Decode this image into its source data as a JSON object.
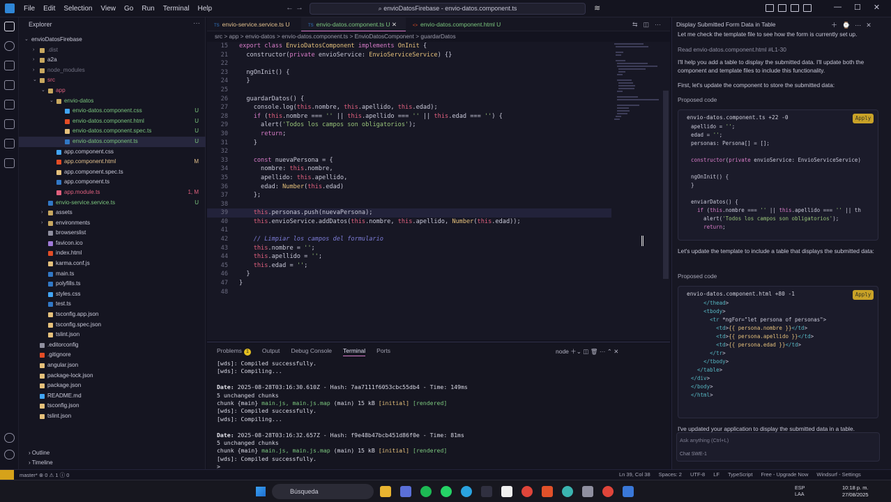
{
  "menu": [
    "File",
    "Edit",
    "Selection",
    "View",
    "Go",
    "Run",
    "Terminal",
    "Help"
  ],
  "title_search": "envioDatosFirebase - envio-datos.component.ts",
  "explorer": {
    "header": "Explorer",
    "outline": "Outline",
    "timeline": "Timeline",
    "items": [
      {
        "label": "envioDatosFirebase",
        "depth": 0,
        "type": "root",
        "color": "#c8c8d8",
        "badge": "",
        "open": true
      },
      {
        "label": ".dist",
        "depth": 1,
        "type": "folder",
        "color": "#6f6f80",
        "badge": "",
        "open": false
      },
      {
        "label": "a2a",
        "depth": 1,
        "type": "folder",
        "color": "#c8c8d8",
        "badge": "",
        "open": false
      },
      {
        "label": "node_modules",
        "depth": 1,
        "type": "folder",
        "color": "#6f6f80",
        "badge": "",
        "open": false
      },
      {
        "label": "src",
        "depth": 1,
        "type": "folder",
        "color": "#e0607e",
        "badge": "",
        "open": true
      },
      {
        "label": "app",
        "depth": 2,
        "type": "folder",
        "color": "#e0607e",
        "badge": "",
        "open": true
      },
      {
        "label": "envio-datos",
        "depth": 3,
        "type": "folder",
        "color": "#7bc67e",
        "badge": "",
        "open": true
      },
      {
        "label": "envio-datos.component.css",
        "depth": 4,
        "type": "css",
        "color": "#7bc67e",
        "badge": "U"
      },
      {
        "label": "envio-datos.component.html",
        "depth": 4,
        "type": "html",
        "color": "#7bc67e",
        "badge": "U"
      },
      {
        "label": "envio-datos.component.spec.ts",
        "depth": 4,
        "type": "spec",
        "color": "#7bc67e",
        "badge": "U"
      },
      {
        "label": "envio-datos.component.ts",
        "depth": 4,
        "type": "ts",
        "color": "#7bc67e",
        "badge": "U",
        "selected": true
      },
      {
        "label": "app.component.css",
        "depth": 3,
        "type": "css",
        "color": "#c8c8d8",
        "badge": ""
      },
      {
        "label": "app.component.html",
        "depth": 3,
        "type": "html",
        "color": "#e2c08d",
        "badge": "M"
      },
      {
        "label": "app.component.spec.ts",
        "depth": 3,
        "type": "spec",
        "color": "#c8c8d8",
        "badge": ""
      },
      {
        "label": "app.component.ts",
        "depth": 3,
        "type": "ts",
        "color": "#c8c8d8",
        "badge": ""
      },
      {
        "label": "app.module.ts",
        "depth": 3,
        "type": "module",
        "color": "#e0607e",
        "badge": "1, M"
      },
      {
        "label": "envio-service.service.ts",
        "depth": 2,
        "type": "ts",
        "color": "#7bc67e",
        "badge": "U"
      },
      {
        "label": "assets",
        "depth": 2,
        "type": "folder",
        "color": "#c8c8d8",
        "badge": "",
        "open": false
      },
      {
        "label": "environments",
        "depth": 2,
        "type": "folder",
        "color": "#c8c8d8",
        "badge": "",
        "open": false
      },
      {
        "label": "browserslist",
        "depth": 2,
        "type": "file",
        "color": "#c8c8d8",
        "badge": ""
      },
      {
        "label": "favicon.ico",
        "depth": 2,
        "type": "img",
        "color": "#c8c8d8",
        "badge": ""
      },
      {
        "label": "index.html",
        "depth": 2,
        "type": "html",
        "color": "#c8c8d8",
        "badge": ""
      },
      {
        "label": "karma.conf.js",
        "depth": 2,
        "type": "js",
        "color": "#c8c8d8",
        "badge": ""
      },
      {
        "label": "main.ts",
        "depth": 2,
        "type": "ts",
        "color": "#c8c8d8",
        "badge": ""
      },
      {
        "label": "polyfills.ts",
        "depth": 2,
        "type": "ts",
        "color": "#c8c8d8",
        "badge": ""
      },
      {
        "label": "styles.css",
        "depth": 2,
        "type": "css",
        "color": "#c8c8d8",
        "badge": ""
      },
      {
        "label": "test.ts",
        "depth": 2,
        "type": "ts",
        "color": "#c8c8d8",
        "badge": ""
      },
      {
        "label": "tsconfig.app.json",
        "depth": 2,
        "type": "json",
        "color": "#c8c8d8",
        "badge": ""
      },
      {
        "label": "tsconfig.spec.json",
        "depth": 2,
        "type": "json",
        "color": "#c8c8d8",
        "badge": ""
      },
      {
        "label": "tslint.json",
        "depth": 2,
        "type": "json",
        "color": "#c8c8d8",
        "badge": ""
      },
      {
        "label": ".editorconfig",
        "depth": 1,
        "type": "gear",
        "color": "#c8c8d8",
        "badge": ""
      },
      {
        "label": ".gitignore",
        "depth": 1,
        "type": "git",
        "color": "#c8c8d8",
        "badge": ""
      },
      {
        "label": "angular.json",
        "depth": 1,
        "type": "json",
        "color": "#c8c8d8",
        "badge": ""
      },
      {
        "label": "package-lock.json",
        "depth": 1,
        "type": "json",
        "color": "#c8c8d8",
        "badge": ""
      },
      {
        "label": "package.json",
        "depth": 1,
        "type": "json",
        "color": "#c8c8d8",
        "badge": ""
      },
      {
        "label": "README.md",
        "depth": 1,
        "type": "md",
        "color": "#c8c8d8",
        "badge": ""
      },
      {
        "label": "tsconfig.json",
        "depth": 1,
        "type": "json",
        "color": "#c8c8d8",
        "badge": ""
      },
      {
        "label": "tslint.json",
        "depth": 1,
        "type": "json",
        "color": "#c8c8d8",
        "badge": ""
      }
    ]
  },
  "tabs": [
    {
      "label": "envio-service.service.ts",
      "color": "#e2c08d",
      "active": false,
      "mark": "U"
    },
    {
      "label": "envio-datos.component.ts",
      "color": "#7bc67e",
      "active": true,
      "mark": "U"
    },
    {
      "label": "envio-datos.component.html",
      "color": "#7bc67e",
      "active": false,
      "mark": "U"
    }
  ],
  "breadcrumb": "src > app > envio-datos > envio-datos.component.ts > EnvioDatosComponent > guardarDatos",
  "code": [
    {
      "n": "15",
      "t": "export class EnvioDatosComponent implements OnInit {"
    },
    {
      "n": "21",
      "t": "  constructor(private envioService: EnvioServiceService) {}"
    },
    {
      "n": "22",
      "t": ""
    },
    {
      "n": "23",
      "t": "  ngOnInit() {"
    },
    {
      "n": "24",
      "t": "  }"
    },
    {
      "n": "25",
      "t": ""
    },
    {
      "n": "26",
      "t": "  guardarDatos() {"
    },
    {
      "n": "27",
      "t": "    console.log(this.nombre, this.apellido, this.edad);"
    },
    {
      "n": "28",
      "t": "    if (this.nombre === '' || this.apellido === '' || this.edad === '') {"
    },
    {
      "n": "29",
      "t": "      alert('Todos los campos son obligatorios');"
    },
    {
      "n": "30",
      "t": "      return;"
    },
    {
      "n": "31",
      "t": "    }"
    },
    {
      "n": "32",
      "t": ""
    },
    {
      "n": "33",
      "t": "    const nuevaPersona = {"
    },
    {
      "n": "34",
      "t": "      nombre: this.nombre,"
    },
    {
      "n": "35",
      "t": "      apellido: this.apellido,"
    },
    {
      "n": "36",
      "t": "      edad: Number(this.edad)"
    },
    {
      "n": "37",
      "t": "    };"
    },
    {
      "n": "38",
      "t": ""
    },
    {
      "n": "39",
      "t": "    this.personas.push(nuevaPersona);",
      "cur": true
    },
    {
      "n": "40",
      "t": "    this.envioService.addDatos(this.nombre, this.apellido, Number(this.edad));"
    },
    {
      "n": "41",
      "t": ""
    },
    {
      "n": "42",
      "t": "    // Limpiar los campos del formulario",
      "cmt": true
    },
    {
      "n": "43",
      "t": "    this.nombre = '';"
    },
    {
      "n": "44",
      "t": "    this.apellido = '';"
    },
    {
      "n": "45",
      "t": "    this.edad = '';"
    },
    {
      "n": "46",
      "t": "  }"
    },
    {
      "n": "47",
      "t": "}"
    },
    {
      "n": "48",
      "t": ""
    }
  ],
  "panel": {
    "tabs": [
      "Problems",
      "Output",
      "Debug Console",
      "Terminal",
      "Ports"
    ],
    "problems_count": "1",
    "shell": "node"
  },
  "terminal": [
    "[wds]: Compiled successfully.",
    "[wds]: Compiling...",
    "",
    "Date: 2025-08-28T03:16:30.610Z - Hash: 7aa7111f6053cbc55db4 - Time: 149ms",
    "5 unchanged chunks",
    "chunk {main} main.js, main.js.map (main) 15 kB [initial] [rendered]",
    "[wds]: Compiled successfully.",
    "[wds]: Compiling...",
    "",
    "Date: 2025-08-28T03:16:32.657Z - Hash: f9e48b47bcb451d86f0e - Time: 81ms",
    "5 unchanged chunks",
    "chunk {main} main.js, main.js.map (main) 15 kB [initial] [rendered]",
    "[wds]: Compiled successfully.",
    ">"
  ],
  "chat": {
    "title": "Display Submitted Form Data in Table",
    "p1": "Let me check the template file to see how the form is currently set up.",
    "p2": "Read envio-datos.component.html #L1-30",
    "p3": "I'll help you add a table to display the submitted data. I'll update both the component and template files to include this functionality.",
    "p4": "First, let's update the component to store the submitted data:",
    "proposed": "Proposed code",
    "file1": "envio-datos.component.ts  +22 -0",
    "apply": "Apply",
    "code1": [
      "apellido = '';",
      "edad = '';",
      "personas: Persona[] = [];",
      "",
      "constructor(private envioService: EnvioServiceService)",
      "",
      "ngOnInit() {",
      "}",
      "",
      "enviarDatos() {",
      "  if (this.nombre === '' || this.apellido === '' || th",
      "    alert('Todos los campos son obligatorios');",
      "    return;"
    ],
    "p5": "Let's update the template to include a table that displays the submitted data:",
    "file2": "envio-datos.component.html  +80 -1",
    "code2": [
      "    </thead>",
      "    <tbody>",
      "      <tr *ngFor=\"let persona of personas\">",
      "        <td>{{ persona.nombre }}</td>",
      "        <td>{{ persona.apellido }}</td>",
      "        <td>{{ persona.edad }}</td>",
      "      </tr>",
      "    </tbody>",
      "  </table>",
      "</div>",
      "</body>",
      "</html>"
    ],
    "p6": "I've updated your application to display the submitted data in a table.",
    "placeholder": "Ask anything (Ctrl+L)",
    "mode": "Chat   SWE-1"
  },
  "status": {
    "branch": "master*  ⊗ 0 ⚠ 1 ⓘ 0",
    "pos": "Ln 39, Col 38",
    "spaces": "Spaces: 2",
    "enc": "UTF-8",
    "eol": "LF",
    "lang": "TypeScript",
    "upgrade": "Free - Upgrade Now",
    "ext": "Windsurf - Settings"
  },
  "taskbar": {
    "search": "Búsqueda",
    "lang": "ESP",
    "region": "LAA",
    "time": "10:18 p. m.",
    "date": "27/08/2025"
  },
  "colors": {
    "keyword": "#d87cc8",
    "class": "#e5c07b",
    "string": "#98c379",
    "func": "#e5c07b",
    "this": "#e0607e",
    "comment": "#7d7dd8",
    "accent": "#d87cc8"
  }
}
